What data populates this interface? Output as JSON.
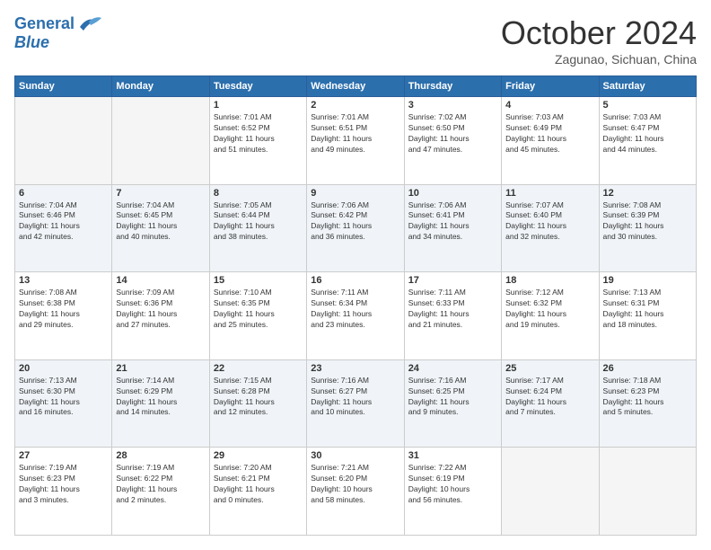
{
  "header": {
    "logo_line1": "General",
    "logo_line2": "Blue",
    "month": "October 2024",
    "location": "Zagunao, Sichuan, China"
  },
  "weekdays": [
    "Sunday",
    "Monday",
    "Tuesday",
    "Wednesday",
    "Thursday",
    "Friday",
    "Saturday"
  ],
  "weeks": [
    [
      {
        "day": "",
        "info": ""
      },
      {
        "day": "",
        "info": ""
      },
      {
        "day": "1",
        "info": "Sunrise: 7:01 AM\nSunset: 6:52 PM\nDaylight: 11 hours\nand 51 minutes."
      },
      {
        "day": "2",
        "info": "Sunrise: 7:01 AM\nSunset: 6:51 PM\nDaylight: 11 hours\nand 49 minutes."
      },
      {
        "day": "3",
        "info": "Sunrise: 7:02 AM\nSunset: 6:50 PM\nDaylight: 11 hours\nand 47 minutes."
      },
      {
        "day": "4",
        "info": "Sunrise: 7:03 AM\nSunset: 6:49 PM\nDaylight: 11 hours\nand 45 minutes."
      },
      {
        "day": "5",
        "info": "Sunrise: 7:03 AM\nSunset: 6:47 PM\nDaylight: 11 hours\nand 44 minutes."
      }
    ],
    [
      {
        "day": "6",
        "info": "Sunrise: 7:04 AM\nSunset: 6:46 PM\nDaylight: 11 hours\nand 42 minutes."
      },
      {
        "day": "7",
        "info": "Sunrise: 7:04 AM\nSunset: 6:45 PM\nDaylight: 11 hours\nand 40 minutes."
      },
      {
        "day": "8",
        "info": "Sunrise: 7:05 AM\nSunset: 6:44 PM\nDaylight: 11 hours\nand 38 minutes."
      },
      {
        "day": "9",
        "info": "Sunrise: 7:06 AM\nSunset: 6:42 PM\nDaylight: 11 hours\nand 36 minutes."
      },
      {
        "day": "10",
        "info": "Sunrise: 7:06 AM\nSunset: 6:41 PM\nDaylight: 11 hours\nand 34 minutes."
      },
      {
        "day": "11",
        "info": "Sunrise: 7:07 AM\nSunset: 6:40 PM\nDaylight: 11 hours\nand 32 minutes."
      },
      {
        "day": "12",
        "info": "Sunrise: 7:08 AM\nSunset: 6:39 PM\nDaylight: 11 hours\nand 30 minutes."
      }
    ],
    [
      {
        "day": "13",
        "info": "Sunrise: 7:08 AM\nSunset: 6:38 PM\nDaylight: 11 hours\nand 29 minutes."
      },
      {
        "day": "14",
        "info": "Sunrise: 7:09 AM\nSunset: 6:36 PM\nDaylight: 11 hours\nand 27 minutes."
      },
      {
        "day": "15",
        "info": "Sunrise: 7:10 AM\nSunset: 6:35 PM\nDaylight: 11 hours\nand 25 minutes."
      },
      {
        "day": "16",
        "info": "Sunrise: 7:11 AM\nSunset: 6:34 PM\nDaylight: 11 hours\nand 23 minutes."
      },
      {
        "day": "17",
        "info": "Sunrise: 7:11 AM\nSunset: 6:33 PM\nDaylight: 11 hours\nand 21 minutes."
      },
      {
        "day": "18",
        "info": "Sunrise: 7:12 AM\nSunset: 6:32 PM\nDaylight: 11 hours\nand 19 minutes."
      },
      {
        "day": "19",
        "info": "Sunrise: 7:13 AM\nSunset: 6:31 PM\nDaylight: 11 hours\nand 18 minutes."
      }
    ],
    [
      {
        "day": "20",
        "info": "Sunrise: 7:13 AM\nSunset: 6:30 PM\nDaylight: 11 hours\nand 16 minutes."
      },
      {
        "day": "21",
        "info": "Sunrise: 7:14 AM\nSunset: 6:29 PM\nDaylight: 11 hours\nand 14 minutes."
      },
      {
        "day": "22",
        "info": "Sunrise: 7:15 AM\nSunset: 6:28 PM\nDaylight: 11 hours\nand 12 minutes."
      },
      {
        "day": "23",
        "info": "Sunrise: 7:16 AM\nSunset: 6:27 PM\nDaylight: 11 hours\nand 10 minutes."
      },
      {
        "day": "24",
        "info": "Sunrise: 7:16 AM\nSunset: 6:25 PM\nDaylight: 11 hours\nand 9 minutes."
      },
      {
        "day": "25",
        "info": "Sunrise: 7:17 AM\nSunset: 6:24 PM\nDaylight: 11 hours\nand 7 minutes."
      },
      {
        "day": "26",
        "info": "Sunrise: 7:18 AM\nSunset: 6:23 PM\nDaylight: 11 hours\nand 5 minutes."
      }
    ],
    [
      {
        "day": "27",
        "info": "Sunrise: 7:19 AM\nSunset: 6:23 PM\nDaylight: 11 hours\nand 3 minutes."
      },
      {
        "day": "28",
        "info": "Sunrise: 7:19 AM\nSunset: 6:22 PM\nDaylight: 11 hours\nand 2 minutes."
      },
      {
        "day": "29",
        "info": "Sunrise: 7:20 AM\nSunset: 6:21 PM\nDaylight: 11 hours\nand 0 minutes."
      },
      {
        "day": "30",
        "info": "Sunrise: 7:21 AM\nSunset: 6:20 PM\nDaylight: 10 hours\nand 58 minutes."
      },
      {
        "day": "31",
        "info": "Sunrise: 7:22 AM\nSunset: 6:19 PM\nDaylight: 10 hours\nand 56 minutes."
      },
      {
        "day": "",
        "info": ""
      },
      {
        "day": "",
        "info": ""
      }
    ]
  ]
}
